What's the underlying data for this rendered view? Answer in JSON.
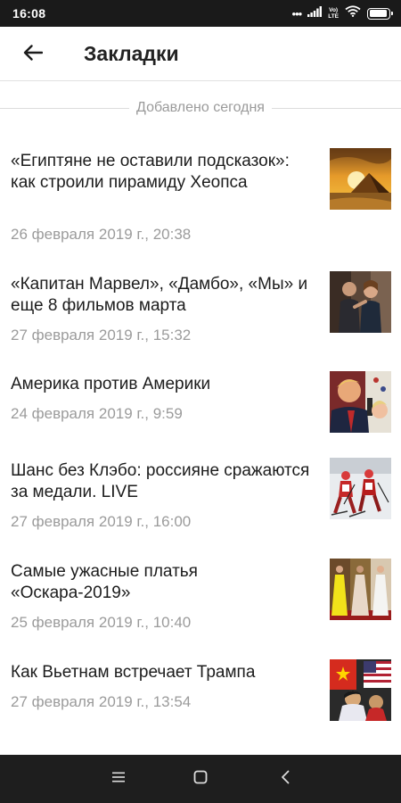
{
  "status_bar": {
    "time": "16:08",
    "dots": "•••",
    "volte_top": "Vo)",
    "volte_bottom": "LTE",
    "battery_level": 0.95
  },
  "header": {
    "back_icon": "arrow-left-icon",
    "title": "Закладки"
  },
  "section": {
    "label": "Добавлено сегодня"
  },
  "bookmarks": [
    {
      "title": "«Египтяне не оставили подсказок»: как строили пирамиду Хеопса",
      "date": "26 февраля 2019 г., 20:38",
      "thumb": "pyramid-sunset-photo"
    },
    {
      "title": "«Капитан Марвел», «Дамбо», «Мы» и еще 8 фильмов марта",
      "date": "27 февраля 2019 г., 15:32",
      "thumb": "movie-still-photo"
    },
    {
      "title": "Америка против Америки",
      "date": "24 февраля 2019 г., 9:59",
      "thumb": "politician-podium-photo"
    },
    {
      "title": "Шанс без Клэбо: россияне сражаются за медали. LIVE",
      "date": "27 февраля 2019 г., 16:00",
      "thumb": "ski-race-photo"
    },
    {
      "title": "Самые ужасные платья «Оскара-2019»",
      "date": "25 февраля 2019 г., 10:40",
      "thumb": "red-carpet-dresses-photo"
    },
    {
      "title": "Как Вьетнам встречает Трампа",
      "date": "27 февраля 2019 г., 13:54",
      "thumb": "flags-crowd-photo"
    }
  ],
  "nav": {
    "menu_icon": "menu-lines-icon",
    "home_icon": "square-home-icon",
    "back_icon": "chevron-back-icon"
  }
}
